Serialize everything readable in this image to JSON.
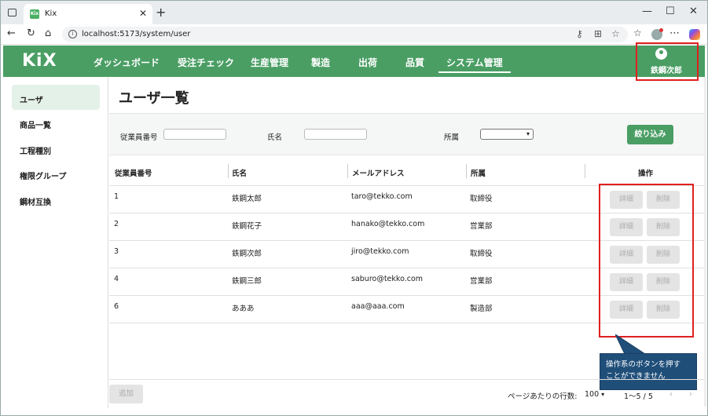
{
  "browser": {
    "tab_title": "Kix",
    "tab_favicon": "Kix",
    "url": "localhost:5173/system/user",
    "icons": [
      "tab-actions-icon",
      "close-tab-icon",
      "new-tab-icon",
      "minimize-icon",
      "maximize-icon",
      "close-window-icon",
      "back-icon",
      "reload-icon",
      "home-icon",
      "site-info-icon",
      "key-icon",
      "split-screen-icon",
      "favorite-star-icon",
      "favorites-icon",
      "profile-icon",
      "more-icon",
      "copilot-icon"
    ]
  },
  "app": {
    "logo": "KiX",
    "menu": [
      {
        "label": "ダッシュボード"
      },
      {
        "label": "受注チェック"
      },
      {
        "label": "生産管理"
      },
      {
        "label": "製造"
      },
      {
        "label": "出荷"
      },
      {
        "label": "品質"
      },
      {
        "label": "システム管理"
      }
    ],
    "active_menu": "システム管理",
    "user_name": "鉄鋼次郎",
    "accent_color": "#4a9e64",
    "highlight_color": "#e02020"
  },
  "sidebar": {
    "items": [
      {
        "label": "ユーザ"
      },
      {
        "label": "商品一覧"
      },
      {
        "label": "工程種別"
      },
      {
        "label": "権限グループ"
      },
      {
        "label": "鋼材互換"
      }
    ],
    "active": "ユーザ"
  },
  "page": {
    "title": "ユーザ一覧"
  },
  "filters": {
    "employee_no_label": "従業員番号",
    "employee_no_value": "",
    "name_label": "氏名",
    "name_value": "",
    "dept_label": "所属",
    "dept_value": "",
    "submit_label": "絞り込み"
  },
  "table": {
    "headers": [
      "従業員番号",
      "氏名",
      "メールアドレス",
      "所属",
      "操作"
    ],
    "rows": [
      {
        "id": "1",
        "name": "鉄鋼太郎",
        "email": "taro@tekko.com",
        "dept": "取締役"
      },
      {
        "id": "2",
        "name": "鉄鋼花子",
        "email": "hanako@tekko.com",
        "dept": "営業部"
      },
      {
        "id": "3",
        "name": "鉄鋼次郎",
        "email": "jiro@tekko.com",
        "dept": "取締役"
      },
      {
        "id": "4",
        "name": "鉄鋼三郎",
        "email": "saburo@tekko.com",
        "dept": "営業部"
      },
      {
        "id": "6",
        "name": "あああ",
        "email": "aaa@aaa.com",
        "dept": "製造部"
      }
    ],
    "detail_label": "詳細",
    "delete_label": "削除"
  },
  "callout": {
    "line1": "操作系のボタンを押す",
    "line2": "ことができません"
  },
  "footer": {
    "add_label": "追加",
    "rows_per_page_label": "ページあたりの行数:",
    "rows_per_page_value": "100",
    "range": "1〜5 / 5"
  }
}
